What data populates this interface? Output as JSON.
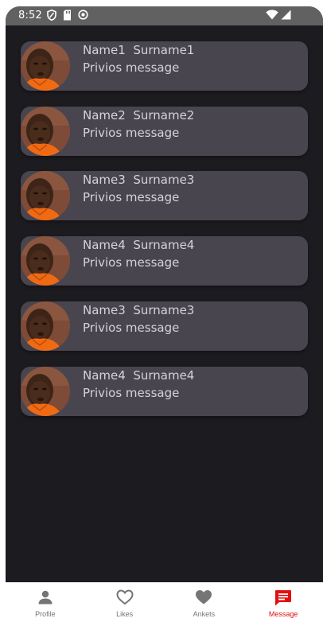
{
  "status_bar": {
    "time": "8:52",
    "left_icons": [
      "shield-icon",
      "sd-card-icon",
      "sync-icon"
    ],
    "right_icons": [
      "wifi-icon",
      "cellular-signal-icon"
    ]
  },
  "messages": [
    {
      "name": "Name1  Surname1",
      "preview": "Privios message"
    },
    {
      "name": "Name2  Surname2",
      "preview": "Privios message"
    },
    {
      "name": "Name3  Surname3",
      "preview": "Privios message"
    },
    {
      "name": "Name4  Surname4",
      "preview": "Privios message"
    },
    {
      "name": "Name3  Surname3",
      "preview": "Privios message"
    },
    {
      "name": "Name4  Surname4",
      "preview": "Privios message"
    }
  ],
  "bottom_nav": {
    "items": [
      {
        "label": "Profile",
        "icon": "person-icon",
        "active": false
      },
      {
        "label": "Likes",
        "icon": "heart-outline-icon",
        "active": false
      },
      {
        "label": "Ankets",
        "icon": "heart-filled-icon",
        "active": false
      },
      {
        "label": "Message",
        "icon": "message-icon",
        "active": true
      }
    ]
  },
  "colors": {
    "background": "#1c1b20",
    "card": "#49454f",
    "status_bar": "#616161",
    "text": "#d6d1dc",
    "nav_inactive": "#757575",
    "nav_active": "#e01010"
  }
}
